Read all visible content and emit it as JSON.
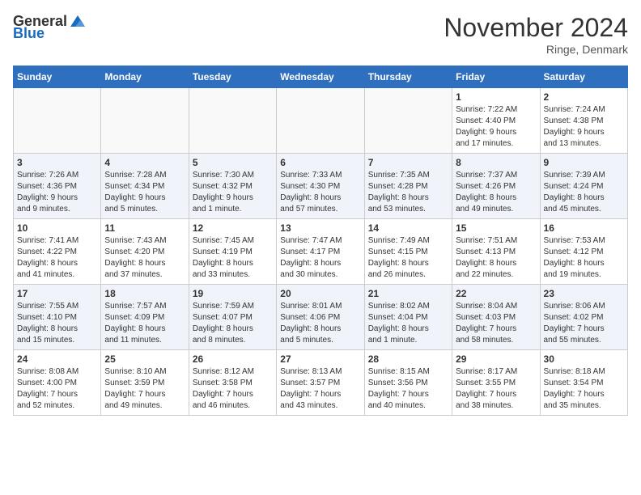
{
  "header": {
    "logo_general": "General",
    "logo_blue": "Blue",
    "month_title": "November 2024",
    "location": "Ringe, Denmark"
  },
  "days_of_week": [
    "Sunday",
    "Monday",
    "Tuesday",
    "Wednesday",
    "Thursday",
    "Friday",
    "Saturday"
  ],
  "weeks": [
    [
      {
        "day": "",
        "info": ""
      },
      {
        "day": "",
        "info": ""
      },
      {
        "day": "",
        "info": ""
      },
      {
        "day": "",
        "info": ""
      },
      {
        "day": "",
        "info": ""
      },
      {
        "day": "1",
        "info": "Sunrise: 7:22 AM\nSunset: 4:40 PM\nDaylight: 9 hours\nand 17 minutes."
      },
      {
        "day": "2",
        "info": "Sunrise: 7:24 AM\nSunset: 4:38 PM\nDaylight: 9 hours\nand 13 minutes."
      }
    ],
    [
      {
        "day": "3",
        "info": "Sunrise: 7:26 AM\nSunset: 4:36 PM\nDaylight: 9 hours\nand 9 minutes."
      },
      {
        "day": "4",
        "info": "Sunrise: 7:28 AM\nSunset: 4:34 PM\nDaylight: 9 hours\nand 5 minutes."
      },
      {
        "day": "5",
        "info": "Sunrise: 7:30 AM\nSunset: 4:32 PM\nDaylight: 9 hours\nand 1 minute."
      },
      {
        "day": "6",
        "info": "Sunrise: 7:33 AM\nSunset: 4:30 PM\nDaylight: 8 hours\nand 57 minutes."
      },
      {
        "day": "7",
        "info": "Sunrise: 7:35 AM\nSunset: 4:28 PM\nDaylight: 8 hours\nand 53 minutes."
      },
      {
        "day": "8",
        "info": "Sunrise: 7:37 AM\nSunset: 4:26 PM\nDaylight: 8 hours\nand 49 minutes."
      },
      {
        "day": "9",
        "info": "Sunrise: 7:39 AM\nSunset: 4:24 PM\nDaylight: 8 hours\nand 45 minutes."
      }
    ],
    [
      {
        "day": "10",
        "info": "Sunrise: 7:41 AM\nSunset: 4:22 PM\nDaylight: 8 hours\nand 41 minutes."
      },
      {
        "day": "11",
        "info": "Sunrise: 7:43 AM\nSunset: 4:20 PM\nDaylight: 8 hours\nand 37 minutes."
      },
      {
        "day": "12",
        "info": "Sunrise: 7:45 AM\nSunset: 4:19 PM\nDaylight: 8 hours\nand 33 minutes."
      },
      {
        "day": "13",
        "info": "Sunrise: 7:47 AM\nSunset: 4:17 PM\nDaylight: 8 hours\nand 30 minutes."
      },
      {
        "day": "14",
        "info": "Sunrise: 7:49 AM\nSunset: 4:15 PM\nDaylight: 8 hours\nand 26 minutes."
      },
      {
        "day": "15",
        "info": "Sunrise: 7:51 AM\nSunset: 4:13 PM\nDaylight: 8 hours\nand 22 minutes."
      },
      {
        "day": "16",
        "info": "Sunrise: 7:53 AM\nSunset: 4:12 PM\nDaylight: 8 hours\nand 19 minutes."
      }
    ],
    [
      {
        "day": "17",
        "info": "Sunrise: 7:55 AM\nSunset: 4:10 PM\nDaylight: 8 hours\nand 15 minutes."
      },
      {
        "day": "18",
        "info": "Sunrise: 7:57 AM\nSunset: 4:09 PM\nDaylight: 8 hours\nand 11 minutes."
      },
      {
        "day": "19",
        "info": "Sunrise: 7:59 AM\nSunset: 4:07 PM\nDaylight: 8 hours\nand 8 minutes."
      },
      {
        "day": "20",
        "info": "Sunrise: 8:01 AM\nSunset: 4:06 PM\nDaylight: 8 hours\nand 5 minutes."
      },
      {
        "day": "21",
        "info": "Sunrise: 8:02 AM\nSunset: 4:04 PM\nDaylight: 8 hours\nand 1 minute."
      },
      {
        "day": "22",
        "info": "Sunrise: 8:04 AM\nSunset: 4:03 PM\nDaylight: 7 hours\nand 58 minutes."
      },
      {
        "day": "23",
        "info": "Sunrise: 8:06 AM\nSunset: 4:02 PM\nDaylight: 7 hours\nand 55 minutes."
      }
    ],
    [
      {
        "day": "24",
        "info": "Sunrise: 8:08 AM\nSunset: 4:00 PM\nDaylight: 7 hours\nand 52 minutes."
      },
      {
        "day": "25",
        "info": "Sunrise: 8:10 AM\nSunset: 3:59 PM\nDaylight: 7 hours\nand 49 minutes."
      },
      {
        "day": "26",
        "info": "Sunrise: 8:12 AM\nSunset: 3:58 PM\nDaylight: 7 hours\nand 46 minutes."
      },
      {
        "day": "27",
        "info": "Sunrise: 8:13 AM\nSunset: 3:57 PM\nDaylight: 7 hours\nand 43 minutes."
      },
      {
        "day": "28",
        "info": "Sunrise: 8:15 AM\nSunset: 3:56 PM\nDaylight: 7 hours\nand 40 minutes."
      },
      {
        "day": "29",
        "info": "Sunrise: 8:17 AM\nSunset: 3:55 PM\nDaylight: 7 hours\nand 38 minutes."
      },
      {
        "day": "30",
        "info": "Sunrise: 8:18 AM\nSunset: 3:54 PM\nDaylight: 7 hours\nand 35 minutes."
      }
    ]
  ]
}
